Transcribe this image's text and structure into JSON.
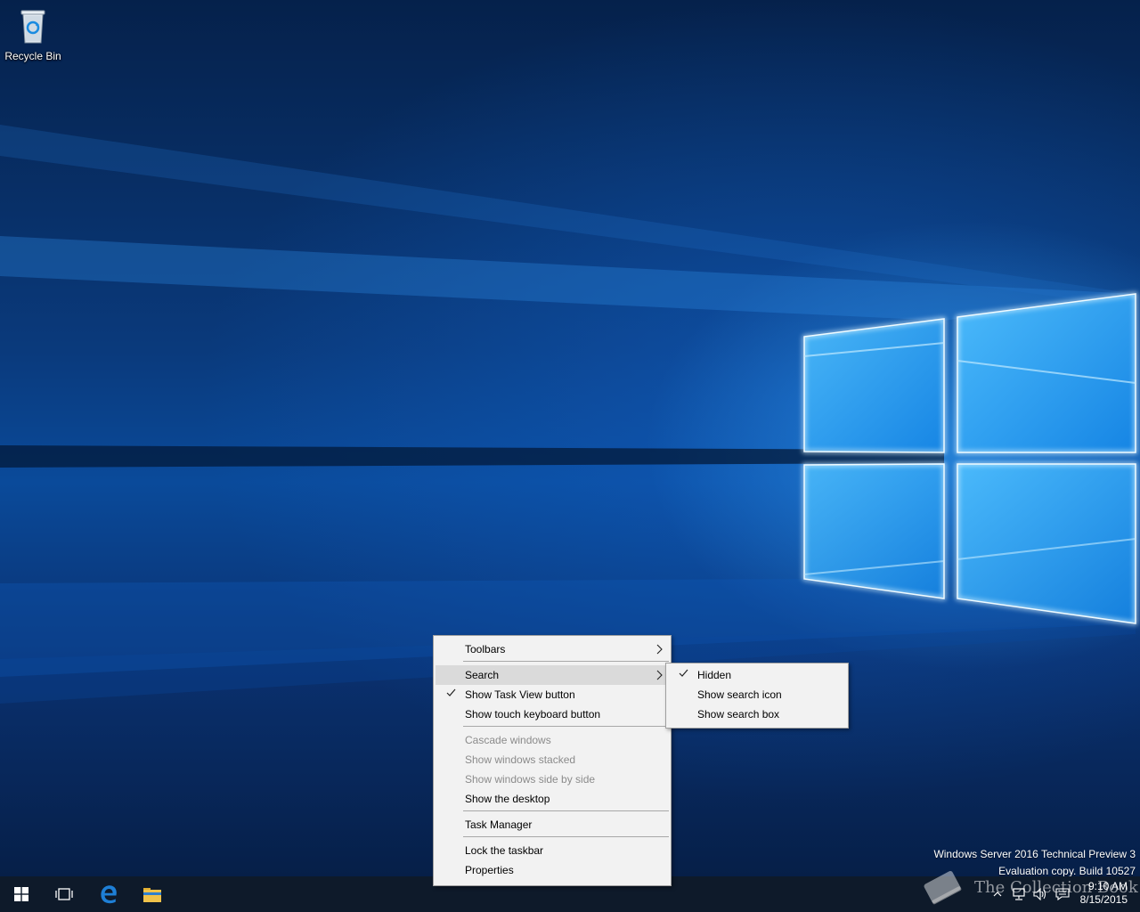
{
  "desktop": {
    "icons": [
      {
        "label": "Recycle Bin",
        "icon": "recycle-bin-icon"
      }
    ],
    "watermark": {
      "line1": "Windows Server 2016 Technical Preview 3",
      "line2": "Evaluation copy. Build 10527"
    },
    "overlay_brand": "The Collection Book"
  },
  "context_menu": {
    "items": [
      {
        "label": "Toolbars",
        "submenu": true
      },
      {
        "label": "Search",
        "submenu": true,
        "highlighted": true
      },
      {
        "label": "Show Task View button",
        "checked": true
      },
      {
        "label": "Show touch keyboard button"
      },
      {
        "label": "Cascade windows",
        "disabled": true
      },
      {
        "label": "Show windows stacked",
        "disabled": true
      },
      {
        "label": "Show windows side by side",
        "disabled": true
      },
      {
        "label": "Show the desktop"
      },
      {
        "label": "Task Manager"
      },
      {
        "label": "Lock the taskbar"
      },
      {
        "label": "Properties"
      }
    ]
  },
  "search_submenu": {
    "items": [
      {
        "label": "Hidden",
        "checked": true
      },
      {
        "label": "Show search icon"
      },
      {
        "label": "Show search box"
      }
    ]
  },
  "taskbar": {
    "buttons": [
      "start-icon",
      "task-view-icon",
      "edge-icon",
      "file-explorer-icon"
    ],
    "tray_icons": [
      "chevron-up-icon",
      "network-icon",
      "volume-icon",
      "action-center-icon"
    ],
    "clock": {
      "time": "9:10 AM",
      "date": "8/15/2015"
    }
  },
  "colors": {
    "taskbar": "#0e1a2a",
    "menu_background": "#f2f2f2",
    "menu_highlight": "#dadada",
    "disabled_text": "#8b8b8b",
    "edge_blue": "#1e7fd6",
    "folder_yellow": "#f0c24a"
  }
}
